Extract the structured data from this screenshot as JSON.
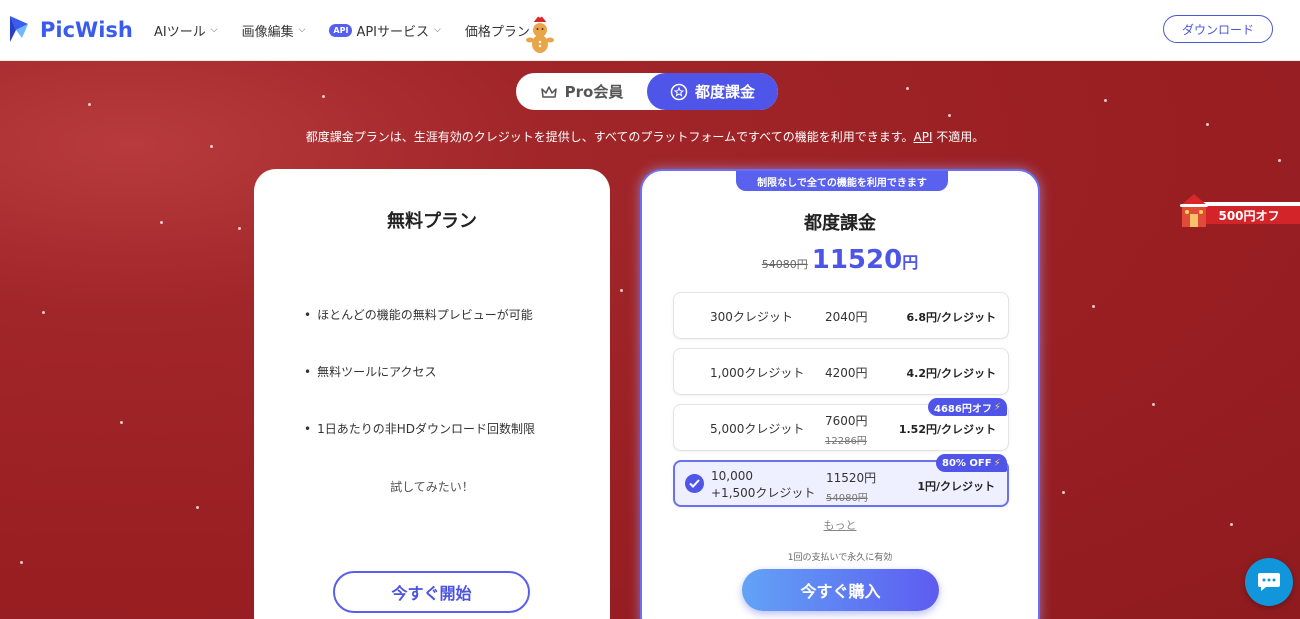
{
  "header": {
    "logo_text": "PicWish",
    "nav": [
      {
        "label": "AIツール",
        "has_dropdown": true
      },
      {
        "label": "画像編集",
        "has_dropdown": true
      },
      {
        "label": "APIサービス",
        "badge": "API",
        "has_dropdown": true
      },
      {
        "label": "価格プラン",
        "has_dropdown": false
      }
    ],
    "download_label": "ダウンロード"
  },
  "toggle": {
    "pro_label": "Pro会員",
    "pay_label": "都度課金",
    "active": "pay"
  },
  "subtitle": {
    "text": "都度課金プランは、生涯有効のクレジットを提供し、すべてのプラットフォームですべての機能を利用できます。",
    "api_link": "API",
    "suffix": " 不適用。"
  },
  "free_plan": {
    "title": "無料プラン",
    "features": [
      "ほとんどの機能の無料プレビューが可能",
      "無料ツールにアクセス",
      "1日あたりの非HDダウンロード回数制限"
    ],
    "trial_text": "試してみたい！",
    "cta": "今すぐ開始"
  },
  "paid_plan": {
    "ribbon": "制限なしで全ての機能を利用できます",
    "title": "都度課金",
    "old_price": "54080円",
    "price": "11520",
    "price_unit": "円",
    "options": [
      {
        "credits": "300クレジット",
        "price": "2040円",
        "old_price": "",
        "per_credit": "6.8円/クレジット",
        "badge": "",
        "selected": false
      },
      {
        "credits": "1,000クレジット",
        "price": "4200円",
        "old_price": "",
        "per_credit": "4.2円/クレジット",
        "badge": "",
        "selected": false
      },
      {
        "credits": "5,000クレジット",
        "price": "7600円",
        "old_price": "12286円",
        "per_credit": "1.52円/クレジット",
        "badge": "4686円オフ",
        "selected": false
      },
      {
        "credits_line1": "10,000",
        "credits_line2": "+1,500クレジット",
        "price": "11520円",
        "old_price": "54080円",
        "per_credit": "1円/クレジット",
        "badge": "80% OFF",
        "selected": true
      }
    ],
    "more_label": "もっと",
    "once_note": "1回の支払いで永久に有効",
    "cta": "今すぐ購入"
  },
  "promo": {
    "label": "500円オフ"
  },
  "colors": {
    "accent": "#4f55e8",
    "background": "#9e1f24",
    "logo": "#3a5bf0"
  }
}
